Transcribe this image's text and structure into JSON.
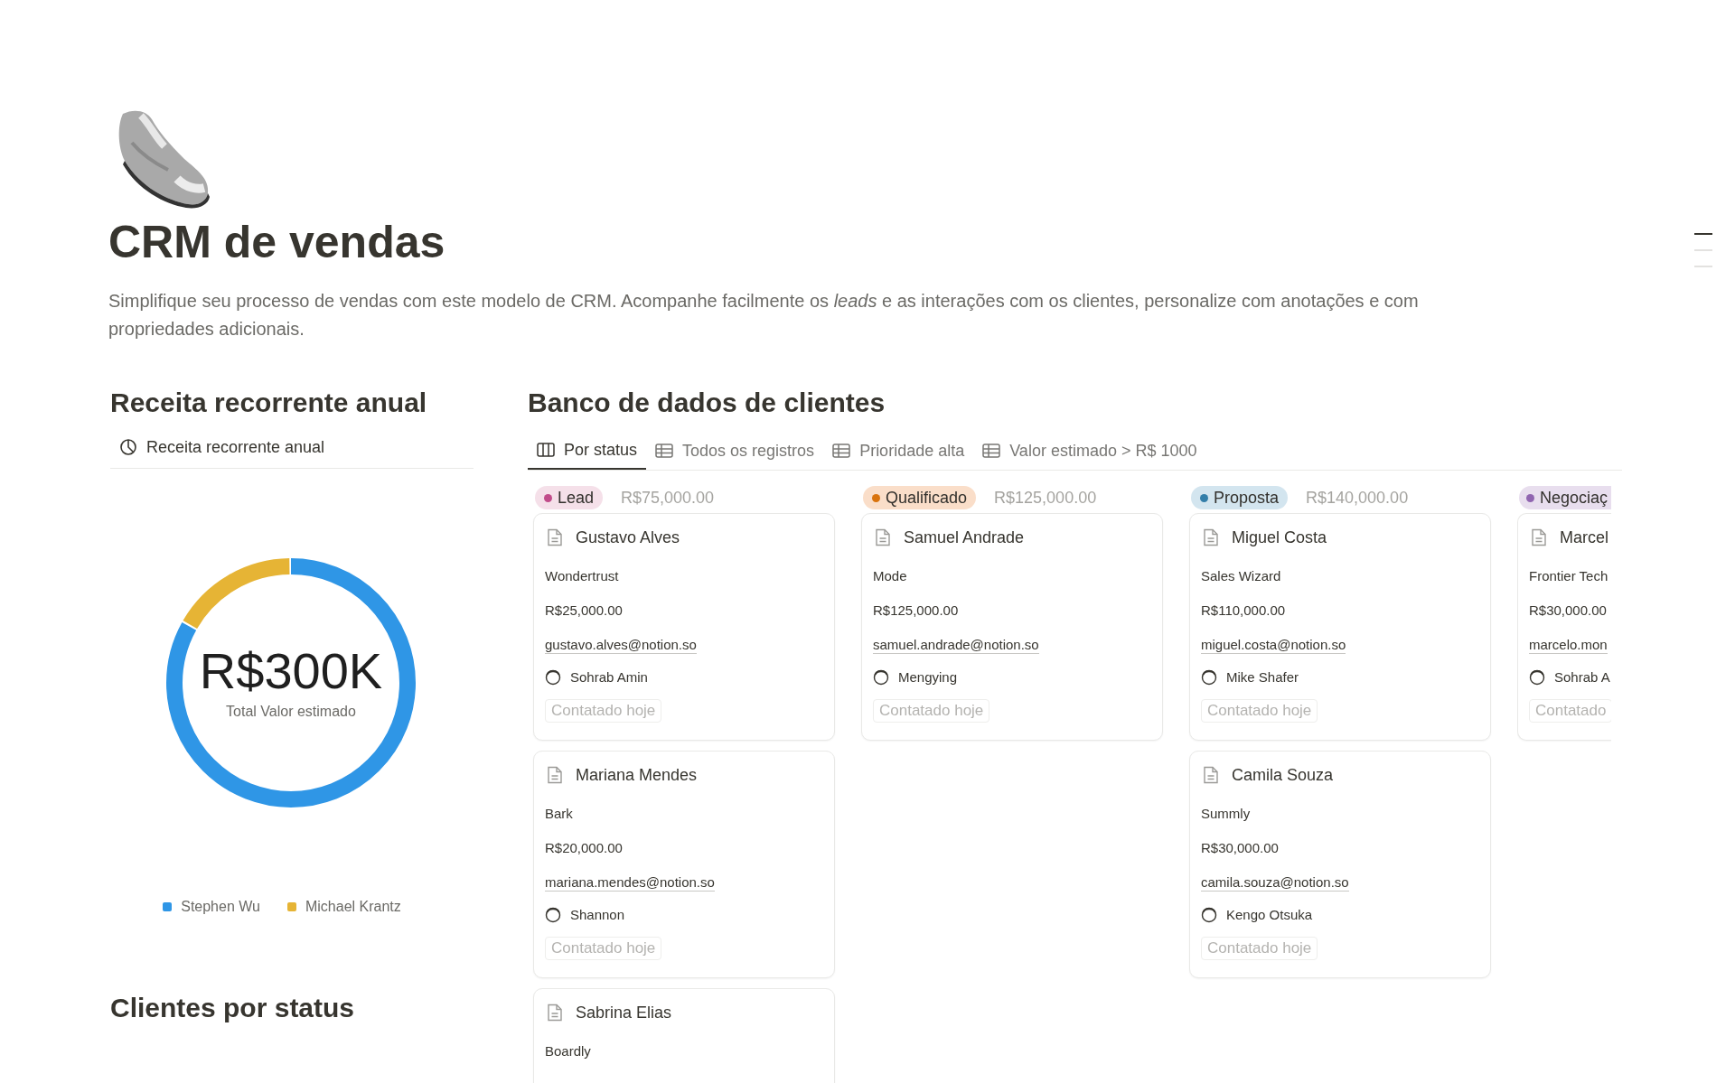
{
  "page": {
    "title": "CRM de vendas",
    "description": "Simplifique seu processo de vendas com este modelo de CRM. Acompanhe facilmente os *leads* e as interações com os clientes, personalize com anotações e com propriedades adicionais."
  },
  "revenue": {
    "heading": "Receita recorrente anual",
    "view_tab": "Receita recorrente anual",
    "total": "R$300K",
    "total_label": "Total Valor estimado",
    "legend": [
      {
        "label": "Stephen Wu",
        "color": "#2f96e6"
      },
      {
        "label": "Michael Krantz",
        "color": "#e6b435"
      }
    ]
  },
  "status_section": {
    "heading": "Clientes por status"
  },
  "database": {
    "heading": "Banco de dados de clientes",
    "tabs": [
      {
        "label": "Por status",
        "kind": "board",
        "selected": true
      },
      {
        "label": "Todos os registros",
        "kind": "table",
        "selected": false
      },
      {
        "label": "Prioridade alta",
        "kind": "table",
        "selected": false
      },
      {
        "label": "Valor estimado > R$ 1000",
        "kind": "table",
        "selected": false
      }
    ],
    "columns": [
      {
        "status": "Lead",
        "color": "#c14c8a",
        "total": "R$75,000.00",
        "cards": [
          {
            "name": "Gustavo Alves",
            "company": "Wondertrust",
            "value": "R$25,000.00",
            "email": "gustavo.alves@notion.so",
            "owner": "Sohrab Amin",
            "tag": "Contatado hoje"
          },
          {
            "name": "Mariana Mendes",
            "company": "Bark",
            "value": "R$20,000.00",
            "email": "mariana.mendes@notion.so",
            "owner": "Shannon",
            "tag": "Contatado hoje"
          },
          {
            "name": "Sabrina Elias",
            "company": "Boardly"
          }
        ]
      },
      {
        "status": "Qualificado",
        "color": "#d9730d",
        "total": "R$125,000.00",
        "cards": [
          {
            "name": "Samuel Andrade",
            "company": "Mode",
            "value": "R$125,000.00",
            "email": "samuel.andrade@notion.so",
            "owner": "Mengying",
            "tag": "Contatado hoje"
          }
        ]
      },
      {
        "status": "Proposta",
        "color": "#337ea9",
        "total": "R$140,000.00",
        "cards": [
          {
            "name": "Miguel Costa",
            "company": "Sales Wizard",
            "value": "R$110,000.00",
            "email": "miguel.costa@notion.so",
            "owner": "Mike Shafer",
            "tag": "Contatado hoje"
          },
          {
            "name": "Camila Souza",
            "company": "Summly",
            "value": "R$30,000.00",
            "email": "camila.souza@notion.so",
            "owner": "Kengo Otsuka",
            "tag": "Contatado hoje"
          }
        ]
      },
      {
        "status": "Negociaç",
        "color": "#9065b0",
        "cards": [
          {
            "name": "Marcel",
            "company": "Frontier Tech",
            "value": "R$30,000.00",
            "email": "marcelo.mon",
            "owner": "Sohrab A",
            "tag": "Contatado"
          }
        ]
      }
    ]
  }
}
